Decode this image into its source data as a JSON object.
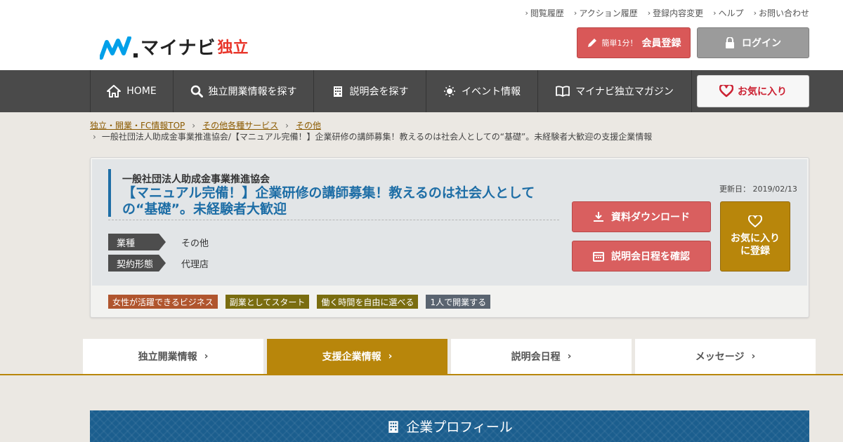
{
  "header": {
    "top_links": [
      "閲覧履歴",
      "アクション履歴",
      "登録内容変更",
      "ヘルプ",
      "お問い合わせ"
    ],
    "logo": {
      "brand": "マイナビ",
      "sub": "独立"
    },
    "register_small": "簡単1分！",
    "register_big": "会員登録",
    "login": "ログイン"
  },
  "nav": {
    "items": [
      "HOME",
      "独立開業情報を探す",
      "説明会を探す",
      "イベント情報",
      "マイナビ独立マガジン"
    ],
    "favorites": "お気に入り"
  },
  "breadcrumb": {
    "links": [
      "独立・開業・FC情報TOP",
      "その他各種サービス",
      "その他"
    ],
    "current": "一般社団法人助成金事業推進協会/【マニュアル完備！】企業研修の講師募集！教えるのは社会人としての“基礎”。未経験者大歓迎の支援企業情報"
  },
  "listing": {
    "company": "一般社団法人助成金事業推進協会",
    "title": "【マニュアル完備！】企業研修の講師募集！教えるのは社会人としての“基礎”。未経験者大歓迎",
    "industry_label": "業種",
    "industry_value": "その他",
    "contract_label": "契約形態",
    "contract_value": "代理店",
    "updated": "更新日： 2019/02/13",
    "download_button": "資料ダウンロード",
    "schedule_button": "説明会日程を確認",
    "favorite_button_line1": "お気に入り",
    "favorite_button_line2": "に登録",
    "features": [
      {
        "label": "女性が活躍できるビジネス",
        "color": "#b0552e"
      },
      {
        "label": "副業としてスタート",
        "color": "#7a6d10"
      },
      {
        "label": "働く時間を自由に選べる",
        "color": "#7a6d10"
      },
      {
        "label": "1人で開業する",
        "color": "#5a6470"
      }
    ]
  },
  "tabs": [
    "独立開業情報",
    "支援企業情報",
    "説明会日程",
    "メッセージ"
  ],
  "active_tab": "支援企業情報",
  "section": {
    "profile_title": "企業プロフィール"
  },
  "colors": {
    "accent_gold": "#b8860b",
    "brand_blue": "#1e6ea6",
    "button_red": "#d95f5f",
    "nav_bg": "#4a4a4a"
  }
}
